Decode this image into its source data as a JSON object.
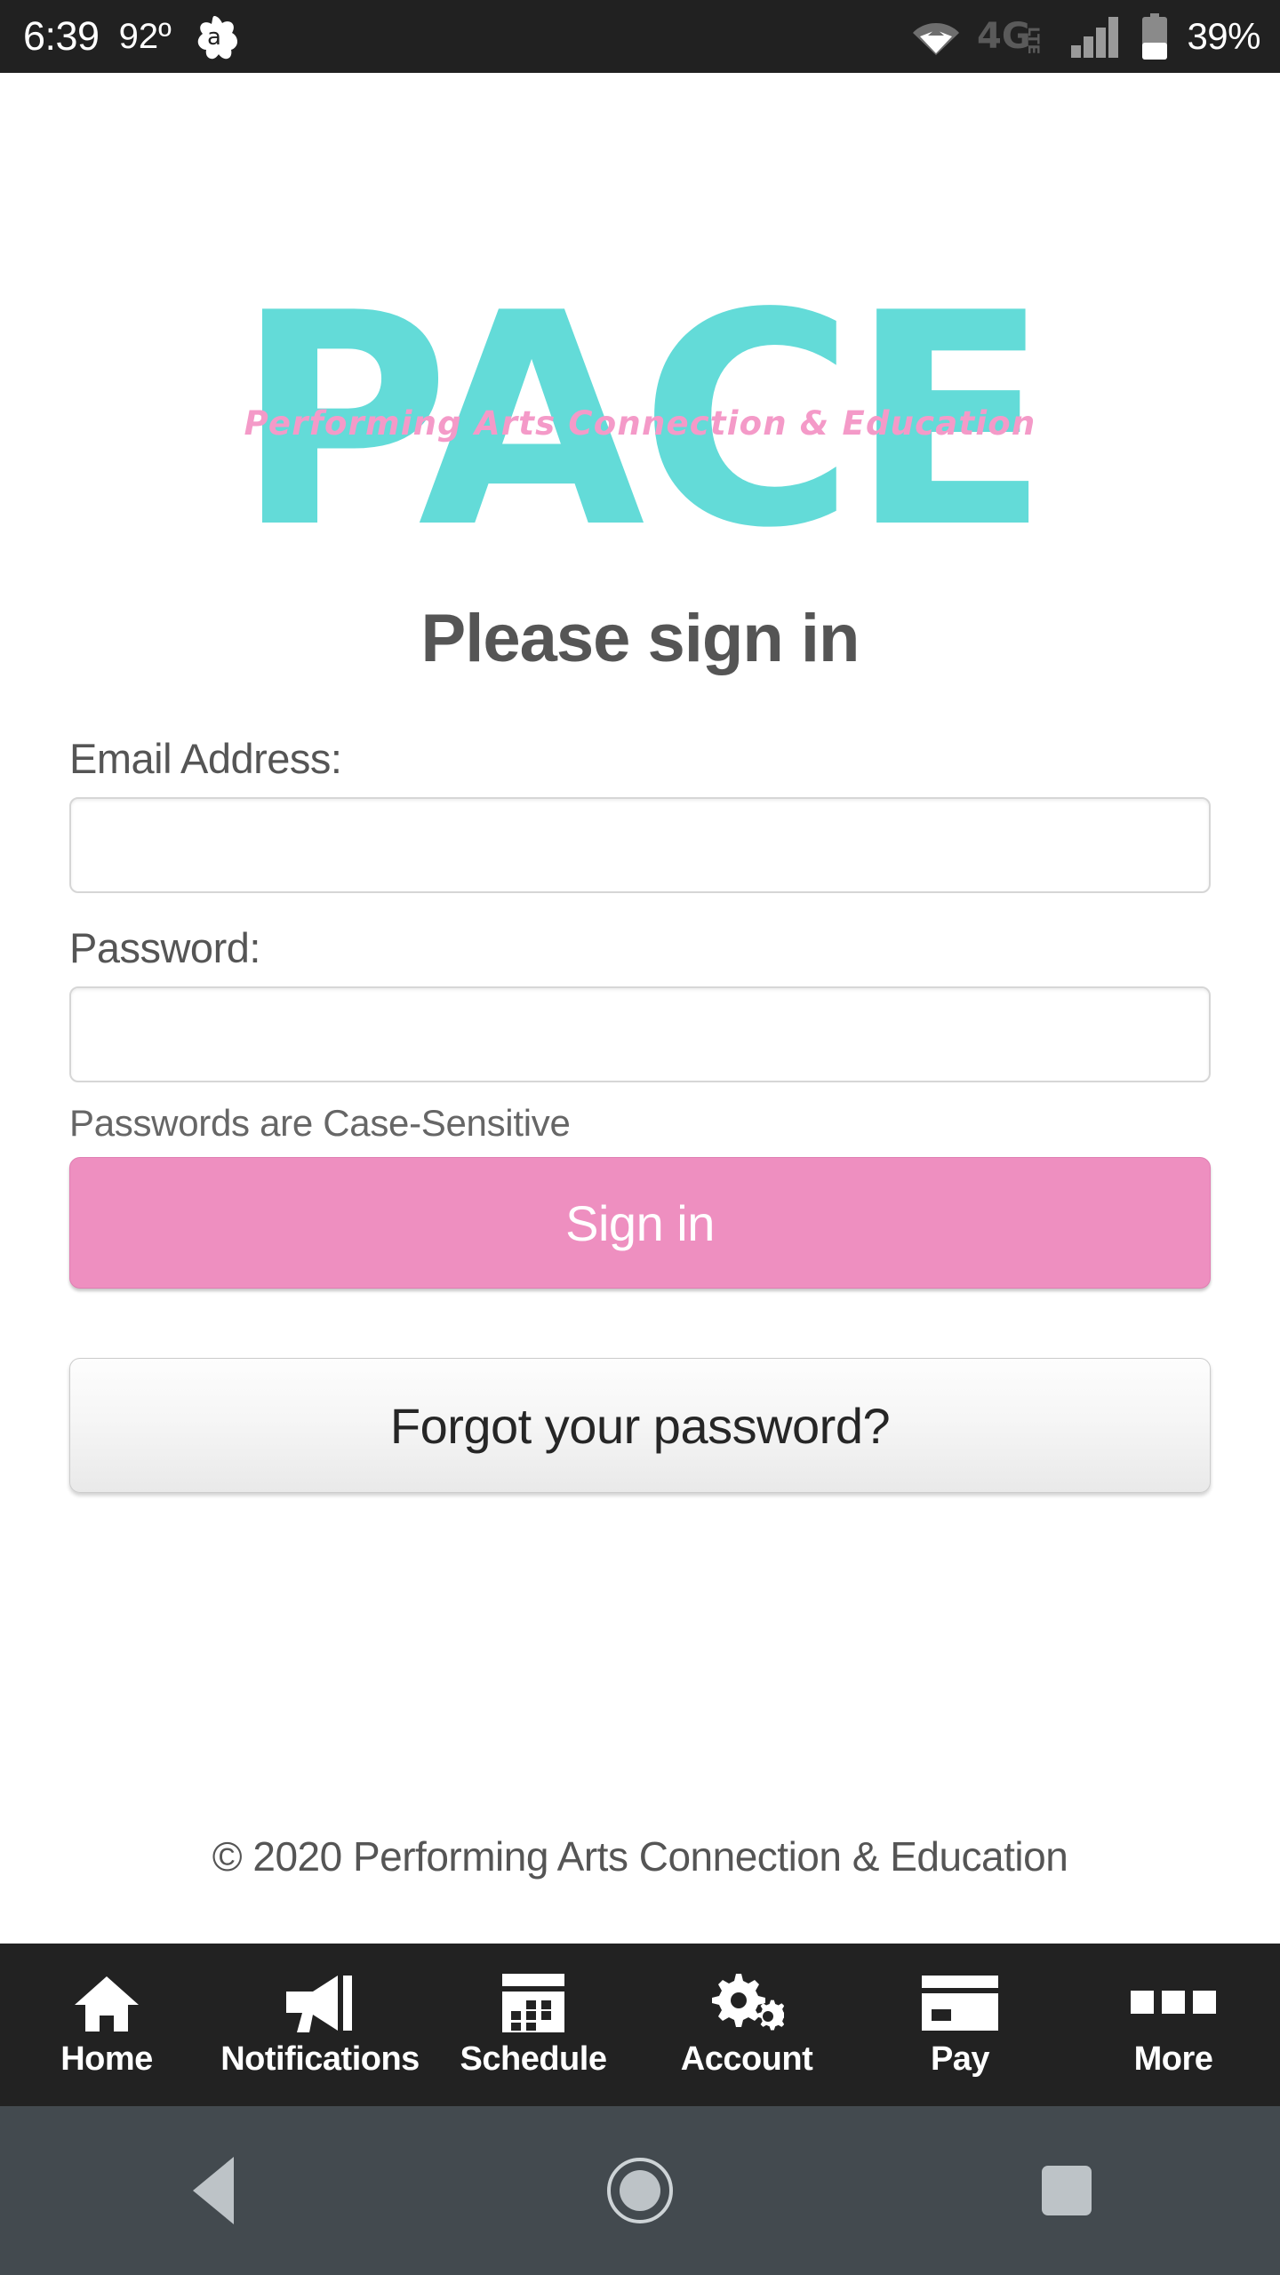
{
  "status_bar": {
    "time": "6:39",
    "temperature": "92º",
    "app_icon": "avast-icon",
    "wifi_icon": "wifi-icon",
    "network_type": "4G",
    "network_suffix": "LTE",
    "signal_icon": "signal-bars-icon",
    "battery_icon": "battery-icon",
    "battery_percent": "39%",
    "background_color": "#212121"
  },
  "logo": {
    "wordmark": "PACE",
    "tagline": "Performing Arts Connection & Education",
    "teal_color": "#63DBD8",
    "pink_color": "#F49AC8"
  },
  "heading": "Please sign in",
  "form": {
    "email": {
      "label": "Email Address:",
      "value": "",
      "placeholder": ""
    },
    "password": {
      "label": "Password:",
      "value": "",
      "placeholder": ""
    },
    "case_note": "Passwords are Case-Sensitive",
    "signin_label": "Sign in",
    "signin_color": "#EE8FC0",
    "forgot_label": "Forgot your password?"
  },
  "footer": {
    "copyright": "© 2020 Performing Arts Connection & Education"
  },
  "bottom_nav": {
    "items": [
      {
        "label": "Home",
        "icon": "home-icon"
      },
      {
        "label": "Notifications",
        "icon": "megaphone-icon"
      },
      {
        "label": "Schedule",
        "icon": "calendar-icon"
      },
      {
        "label": "Account",
        "icon": "gears-icon"
      },
      {
        "label": "Pay",
        "icon": "credit-card-icon"
      },
      {
        "label": "More",
        "icon": "three-squares-icon"
      }
    ]
  },
  "system_nav": {
    "back": "back-button",
    "home": "home-button",
    "recents": "recents-button"
  }
}
